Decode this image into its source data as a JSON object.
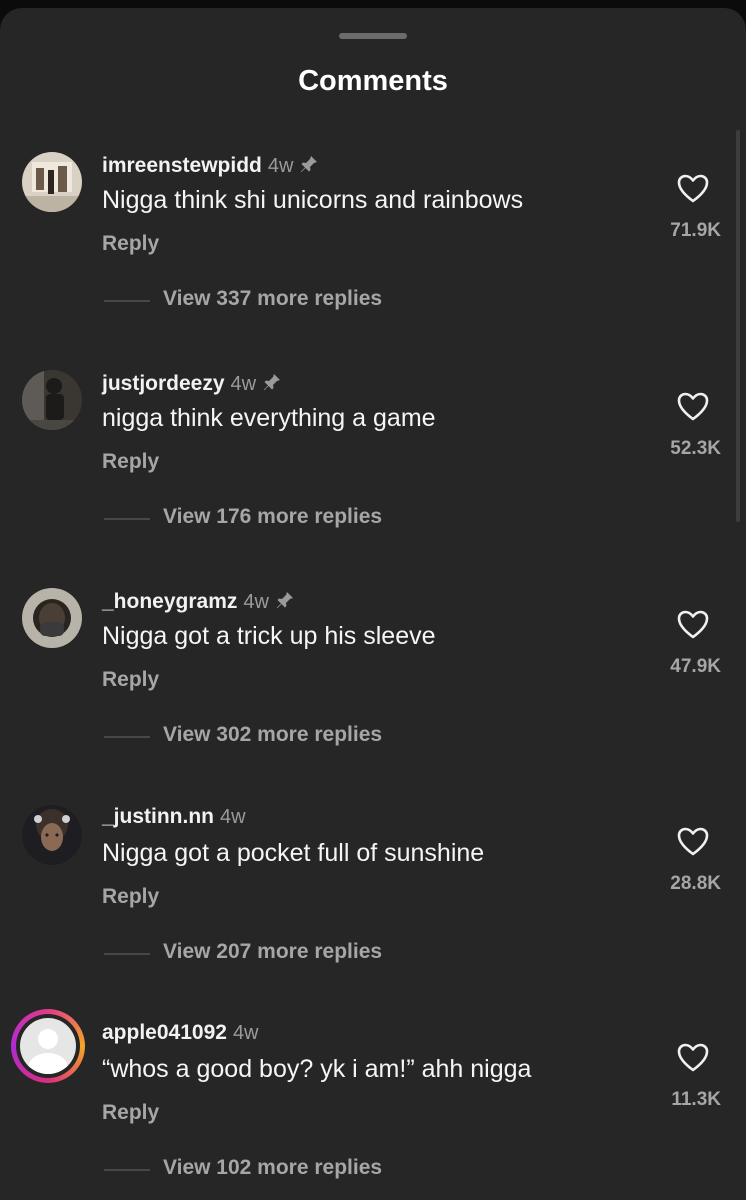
{
  "header": {
    "title": "Comments"
  },
  "reply_label": "Reply",
  "comments": [
    {
      "username": "imreenstewpidd",
      "time": "4w",
      "pinned": true,
      "text": "Nigga think shi unicorns and rainbows",
      "likes": "71.9K",
      "view_more": "View 337 more replies",
      "avatar": "photo-avatar",
      "avatar_colors": [
        "#d9d2c4",
        "#6b5a4a",
        "#2e2520"
      ]
    },
    {
      "username": "justjordeezy",
      "time": "4w",
      "pinned": true,
      "text": "nigga think everything a game",
      "likes": "52.3K",
      "view_more": "View 176 more replies",
      "avatar": "photo-avatar",
      "avatar_colors": [
        "#3a3733",
        "#1c1b1a",
        "#5e5a55"
      ]
    },
    {
      "username": "_honeygramz",
      "time": "4w",
      "pinned": true,
      "text": "Nigga got a trick up his sleeve",
      "likes": "47.9K",
      "view_more": "View 302 more replies",
      "avatar": "photo-avatar",
      "avatar_colors": [
        "#b8b3a8",
        "#4a3f35",
        "#2a2420"
      ]
    },
    {
      "username": "_justinn.nn",
      "time": "4w",
      "pinned": false,
      "text": "Nigga got a pocket full of sunshine",
      "likes": "28.8K",
      "view_more": "View 207 more replies",
      "avatar": "photo-avatar",
      "avatar_colors": [
        "#1e1e22",
        "#8a6a55",
        "#3b302a"
      ]
    },
    {
      "username": "apple041092",
      "time": "4w",
      "pinned": false,
      "text": "“whos a good boy? yk i am!” ahh nigga",
      "likes": "11.3K",
      "view_more": "View 102 more replies",
      "avatar": "default-avatar-with-story-ring",
      "avatar_colors": [
        "#e6e6e6",
        "#ffffff",
        "#e23a8a"
      ]
    }
  ]
}
